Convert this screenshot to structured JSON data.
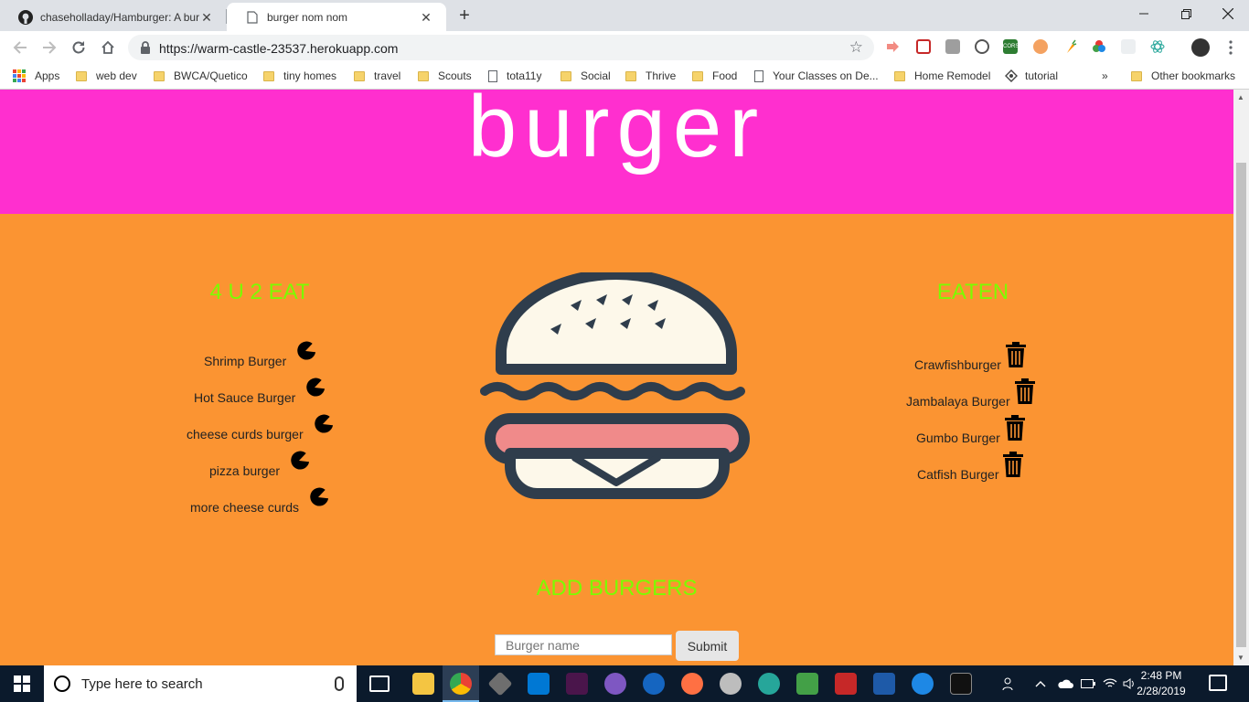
{
  "browser": {
    "tabs": [
      {
        "title": "chaseholladay/Hamburger: A bur",
        "active": false
      },
      {
        "title": "burger nom nom",
        "active": true
      }
    ],
    "url": "https://warm-castle-23537.herokuapp.com",
    "bookmarks": [
      {
        "label": "Apps",
        "type": "apps"
      },
      {
        "label": "web dev",
        "type": "folder"
      },
      {
        "label": "BWCA/Quetico",
        "type": "folder"
      },
      {
        "label": "tiny homes",
        "type": "folder"
      },
      {
        "label": "travel",
        "type": "folder"
      },
      {
        "label": "Scouts",
        "type": "folder"
      },
      {
        "label": "tota11y",
        "type": "page"
      },
      {
        "label": "Social",
        "type": "folder"
      },
      {
        "label": "Thrive",
        "type": "folder"
      },
      {
        "label": "Food",
        "type": "folder"
      },
      {
        "label": "Your Classes on De...",
        "type": "page"
      },
      {
        "label": "Home Remodel",
        "type": "folder"
      },
      {
        "label": "tutorial",
        "type": "page"
      }
    ],
    "overflow_label": "»",
    "other_bookmarks": "Other bookmarks"
  },
  "page": {
    "title": "burger",
    "to_eat_heading": "4 U 2 EAT",
    "eaten_heading": "EATEN",
    "to_eat": [
      "Shrimp Burger",
      "Hot Sauce Burger",
      "cheese curds burger",
      "pizza burger",
      "more cheese curds"
    ],
    "eaten": [
      "Crawfishburger",
      "Jambalaya Burger",
      "Gumbo Burger",
      "Catfish Burger"
    ],
    "add_heading": "ADD BURGERS",
    "input_placeholder": "Burger name",
    "submit_label": "Submit"
  },
  "taskbar": {
    "search_placeholder": "Type here to search",
    "time": "2:48 PM",
    "date": "2/28/2019"
  },
  "colors": {
    "hero_bg": "#ff2fcf",
    "page_bg": "#fb9432",
    "heading": "#7cfc00",
    "burger_dark": "#2f3d4c",
    "bun": "#fdf8ea",
    "patty": "#f08a8a"
  }
}
